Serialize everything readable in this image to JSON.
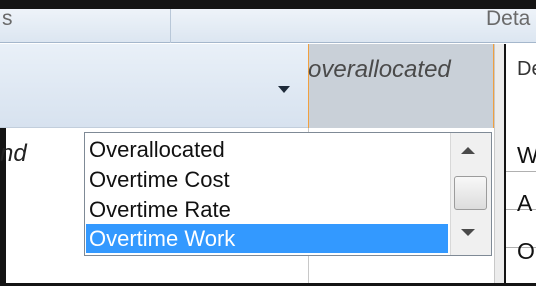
{
  "header_top": {
    "left_fragment": "s",
    "right_fragment": "Deta"
  },
  "column_header": {
    "selected_label": "overallocated"
  },
  "right_column": {
    "header": "De",
    "rows": [
      "W",
      "A",
      "O"
    ]
  },
  "left_cell": {
    "text": "nd"
  },
  "field_list": {
    "items": [
      "Overallocated",
      "Overtime Cost",
      "Overtime Rate",
      "Overtime Work"
    ],
    "selected_index": 3
  },
  "colors": {
    "selection": "#3399ff",
    "header_bg": "#dce6f1",
    "accent_border": "#f0a040"
  }
}
